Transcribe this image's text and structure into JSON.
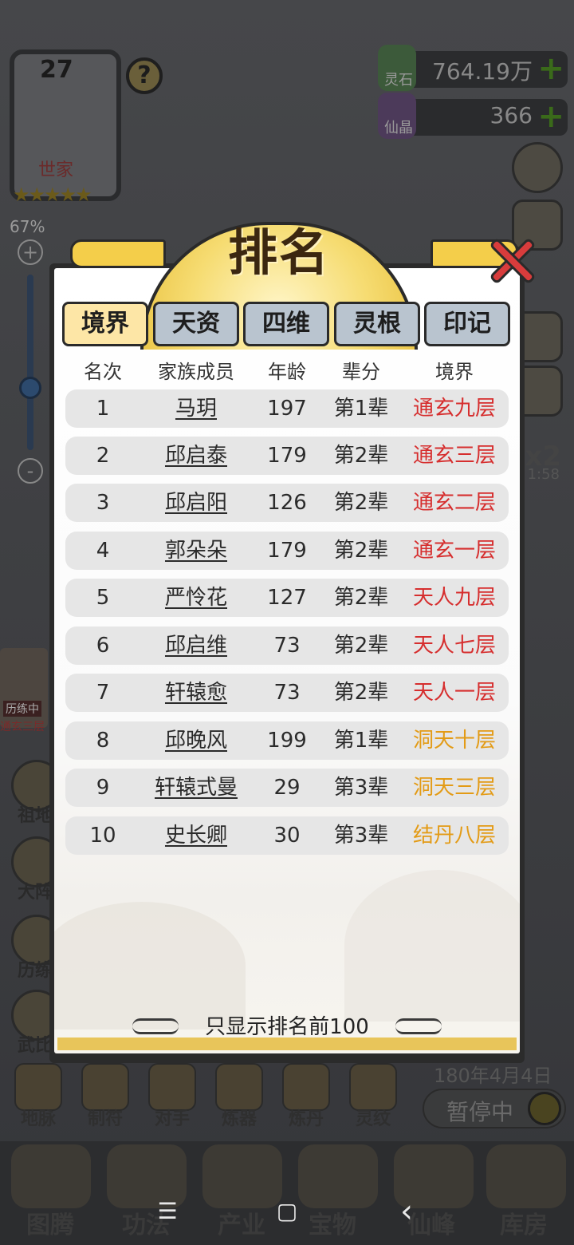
{
  "background": {
    "player": {
      "level": "27",
      "title": "世家",
      "stars": "★★★★★",
      "progress_percent": "67%"
    },
    "help_label": "?",
    "resources": [
      {
        "label": "灵石",
        "value": "764.19万",
        "add": "+"
      },
      {
        "label": "仙晶",
        "value": "366",
        "add": "+"
      }
    ],
    "speed": {
      "multiplier": "x2",
      "time": "1:58"
    },
    "zoom": {
      "plus": "+",
      "minus": "-"
    },
    "left_menu": [
      "祖地",
      "大阵",
      "历练",
      "武比"
    ],
    "character": {
      "status": "历练中",
      "realm": "通玄三层"
    },
    "date": "180年4月4日",
    "pause_label": "暂停中",
    "skill_bar": [
      "地脉",
      "制符",
      "对手",
      "炼器",
      "炼丹",
      "灵纹"
    ],
    "bottom_nav": [
      "图腾",
      "功法",
      "产业",
      "宝物",
      "仙峰",
      "库房"
    ],
    "system_nav": {
      "menu": "☰",
      "home": "▢",
      "back": "‹"
    }
  },
  "dialog": {
    "title": "排名",
    "close_icon": "close-icon",
    "tabs": [
      {
        "label": "境界",
        "active": true
      },
      {
        "label": "天资",
        "active": false
      },
      {
        "label": "四维",
        "active": false
      },
      {
        "label": "灵根",
        "active": false
      },
      {
        "label": "印记",
        "active": false
      }
    ],
    "columns": {
      "rank": "名次",
      "name": "家族成员",
      "age": "年龄",
      "generation": "辈分",
      "realm": "境界"
    },
    "rows": [
      {
        "rank": "1",
        "name": "马玥",
        "age": "197",
        "generation": "第1辈",
        "realm": "通玄九层",
        "realm_color": "#d62e2e"
      },
      {
        "rank": "2",
        "name": "邱启泰",
        "age": "179",
        "generation": "第2辈",
        "realm": "通玄三层",
        "realm_color": "#d62e2e"
      },
      {
        "rank": "3",
        "name": "邱启阳",
        "age": "126",
        "generation": "第2辈",
        "realm": "通玄二层",
        "realm_color": "#d62e2e"
      },
      {
        "rank": "4",
        "name": "郭朵朵",
        "age": "179",
        "generation": "第2辈",
        "realm": "通玄一层",
        "realm_color": "#d62e2e"
      },
      {
        "rank": "5",
        "name": "严怜花",
        "age": "127",
        "generation": "第2辈",
        "realm": "天人九层",
        "realm_color": "#d62e2e"
      },
      {
        "rank": "6",
        "name": "邱启维",
        "age": "73",
        "generation": "第2辈",
        "realm": "天人七层",
        "realm_color": "#d62e2e"
      },
      {
        "rank": "7",
        "name": "轩辕愈",
        "age": "73",
        "generation": "第2辈",
        "realm": "天人一层",
        "realm_color": "#d62e2e"
      },
      {
        "rank": "8",
        "name": "邱晚风",
        "age": "199",
        "generation": "第1辈",
        "realm": "洞天十层",
        "realm_color": "#e39b16"
      },
      {
        "rank": "9",
        "name": "轩辕式曼",
        "age": "29",
        "generation": "第3辈",
        "realm": "洞天三层",
        "realm_color": "#e39b16"
      },
      {
        "rank": "10",
        "name": "史长卿",
        "age": "30",
        "generation": "第3辈",
        "realm": "结丹八层",
        "realm_color": "#e39b16"
      }
    ],
    "footnote": "只显示排名前100"
  }
}
